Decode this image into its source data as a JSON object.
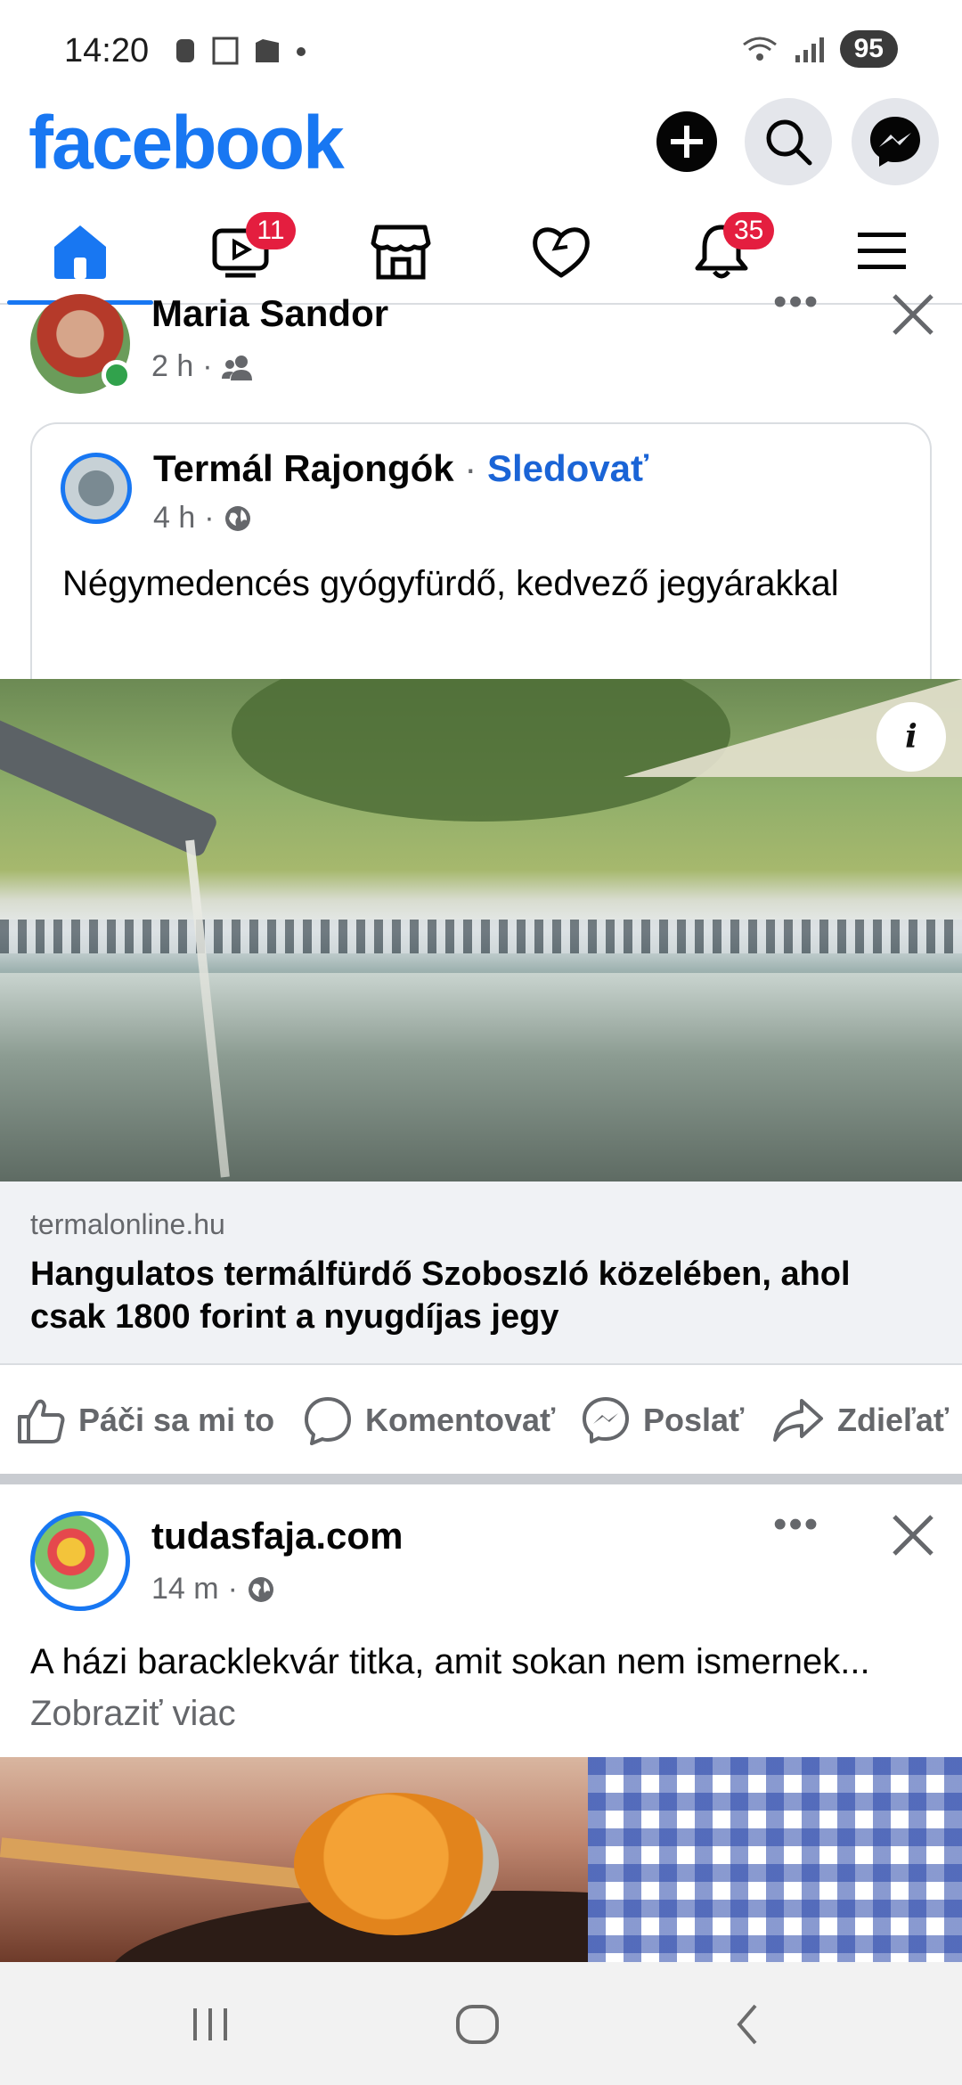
{
  "status_bar": {
    "time": "14:20",
    "battery": "95"
  },
  "header": {
    "logo": "facebook",
    "brand_color": "#1877f2"
  },
  "tabs": {
    "video_badge": "11",
    "notifications_badge": "35",
    "active": "home",
    "items": [
      "home-icon",
      "video-icon",
      "marketplace-icon",
      "dating-icon",
      "bell-icon",
      "menu-icon"
    ]
  },
  "post1": {
    "sharer_name": "Maria Sandor",
    "sharer_time": "2 h",
    "page_name": "Termál Rajongók",
    "page_separator": "·",
    "follow_label": "Sledovať",
    "page_time": "4 h",
    "text": "Négymedencés gyógyfürdő, kedvező jegyárakkal",
    "link_domain": "termalonline.hu",
    "link_title": "Hangulatos termálfürdő Szoboszló közelében, ahol csak 1800 forint a nyugdíjas jegy"
  },
  "actions": {
    "like": "Páči sa mi to",
    "comment": "Komentovať",
    "send": "Poslať",
    "share": "Zdieľať"
  },
  "post2": {
    "page_name": "tudasfaja.com",
    "time": "14 m",
    "text": "A házi baracklekvár titka, amit sokan nem ismernek...",
    "see_more": "Zobraziť viac"
  }
}
